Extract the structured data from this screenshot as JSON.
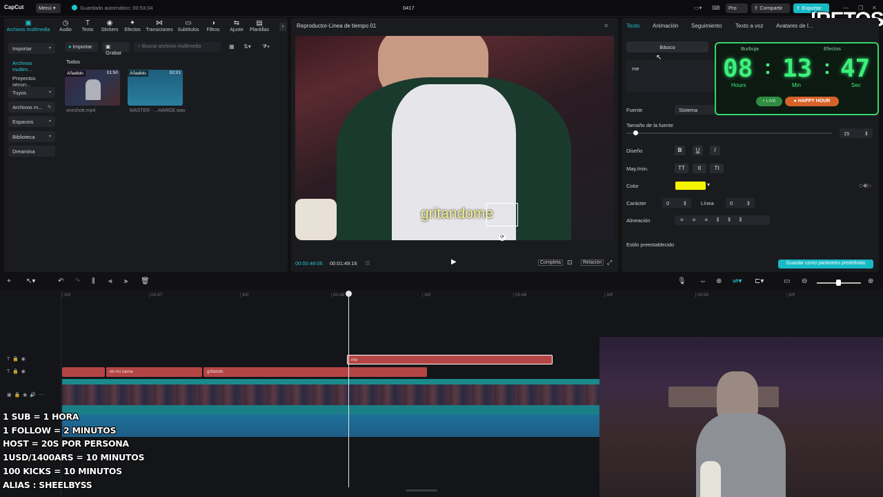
{
  "titlebar": {
    "logo": "CapCut",
    "menu": "Menú",
    "autosave": "Guardado automático: 00:53:34",
    "project": "0417",
    "pro": "Pro",
    "share": "Compartir",
    "export": "Exportar"
  },
  "overlay_brand": "!RETOS",
  "toolbar": {
    "tools": [
      "Archivos multimedia",
      "Audio",
      "Texto",
      "Stickers",
      "Efectos",
      "Transiciones",
      "Subtítulos",
      "Filtros",
      "Ajuste",
      "Plantillas"
    ]
  },
  "sidebar": {
    "items": [
      "Importar",
      "Archivos multim...",
      "Proyectos secun...",
      "Tuyos",
      "Archivos m...",
      "Espacios",
      "Biblioteca",
      "Dreamina"
    ]
  },
  "media": {
    "import_btn": "Importar",
    "record_btn": "Grabar",
    "search_placeholder": "Buscar archivos multimedia",
    "section": "Todos",
    "items": [
      {
        "badge": "Añadido",
        "duration": "01:50",
        "name": "oneshott.mp4"
      },
      {
        "badge": "Añadido",
        "duration": "02:01",
        "name": "MASTER - ...HARGE.wav"
      }
    ]
  },
  "player": {
    "title": "Reproductor-Línea de tiempo 01",
    "caption": "gritandome",
    "current_time": "00:00:48:06",
    "duration": "00:01:49:16",
    "full_label": "Completa",
    "ratio_label": "Relación"
  },
  "inspector": {
    "tabs": [
      "Texto",
      "Animación",
      "Seguimiento",
      "Texto a voz",
      "Avatares de I..."
    ],
    "subtabs": [
      "Básico",
      "Burbuja",
      "Efectos"
    ],
    "text_value": "me",
    "font_label": "Fuente",
    "font_value": "Sistema",
    "size_label": "Tamaño de la fuente",
    "size_value": "15",
    "design_label": "Diseño",
    "case_label": "May./min.",
    "case_options": [
      "TT",
      "tt",
      "Tt"
    ],
    "color_label": "Color",
    "color_value": "#f5f500",
    "char_label": "Carácter",
    "char_value": "0",
    "line_label": "Línea",
    "line_value": "0",
    "align_label": "Alineación",
    "preset_label": "Estilo preestablecido",
    "save_preset": "Guardar como parámetro predefinido"
  },
  "timer": {
    "hours": "08",
    "minutes": "13",
    "seconds": "47",
    "hours_label": "Hours",
    "minutes_label": "Min",
    "seconds_label": "Sec",
    "live": "+ LIVE",
    "happy": "HAPPY HOUR"
  },
  "timeline": {
    "ruler": [
      "30f",
      "00:47",
      "30f",
      "00:48",
      "30f",
      "00:49",
      "30f",
      "00:50",
      "30f"
    ],
    "clips_top": [
      {
        "label": "me"
      }
    ],
    "clips_text": [
      {
        "label": ""
      },
      {
        "label": "en mi cama"
      },
      {
        "label": "gritando"
      }
    ]
  },
  "overlay_rules": [
    "1 SUB = 1 HORA",
    "1 FOLLOW = 2 MINUTOS",
    "HOST = 20S POR PERSONA",
    "1USD/1400ARS = 10 MINUTOS",
    "100 KICKS = 10 MINUTOS",
    "ALIAS : SHEELBYSS"
  ],
  "colors": {
    "accent": "#1fc6cf",
    "clip_red": "#b44545",
    "timer_green": "#3ef07a"
  }
}
